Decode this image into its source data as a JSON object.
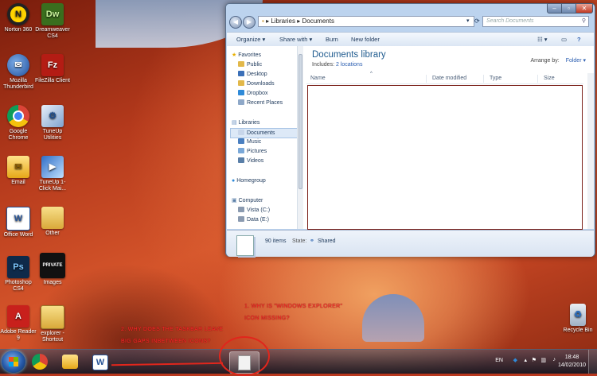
{
  "desktop": {
    "icons": [
      {
        "label": "Norton 360",
        "icon": "norton-icon"
      },
      {
        "label": "Dreamweaver CS4",
        "icon": "dreamweaver-icon"
      },
      {
        "label": "Mozilla Thunderbird",
        "icon": "thunderbird-icon"
      },
      {
        "label": "FileZilla Client",
        "icon": "filezilla-icon"
      },
      {
        "label": "Google Chrome",
        "icon": "chrome-icon"
      },
      {
        "label": "TuneUp Utilities",
        "icon": "tuneup-icon"
      },
      {
        "label": "Email",
        "icon": "email-icon"
      },
      {
        "label": "TuneUp 1-Click Mai...",
        "icon": "tuneup-1click-icon"
      },
      {
        "label": "Office Word",
        "icon": "word-icon"
      },
      {
        "label": "Other",
        "icon": "folder-icon"
      },
      {
        "label": "Photoshop CS4",
        "icon": "photoshop-icon"
      },
      {
        "label": "Images",
        "icon": "images-icon",
        "overlay": "PRIVATE"
      },
      {
        "label": "Adobe Reader 9",
        "icon": "adobe-reader-icon"
      },
      {
        "label": "explorer - Shortcut",
        "icon": "explorer-shortcut-icon"
      },
      {
        "label": "Recycle Bin",
        "icon": "recycle-bin-icon"
      }
    ]
  },
  "window": {
    "address": {
      "segments": [
        "Libraries",
        "Documents"
      ]
    },
    "search_placeholder": "Search Documents",
    "toolbar": {
      "organize": "Organize",
      "share_with": "Share with",
      "burn": "Burn",
      "new_folder": "New folder"
    },
    "nav": {
      "favorites": {
        "title": "Favorites",
        "items": [
          "Public",
          "Desktop",
          "Downloads",
          "Dropbox",
          "Recent Places"
        ]
      },
      "libraries": {
        "title": "Libraries",
        "items": [
          "Documents",
          "Music",
          "Pictures",
          "Videos"
        ]
      },
      "homegroup": "Homegroup",
      "computer": {
        "title": "Computer",
        "items": [
          "Vista (C:)",
          "Data (E:)"
        ]
      }
    },
    "library": {
      "title": "Documents library",
      "includes_label": "Includes:",
      "includes_link": "2 locations",
      "arrange_label": "Arrange by:",
      "arrange_value": "Folder"
    },
    "columns": [
      "Name",
      "Date modified",
      "Type",
      "Size"
    ],
    "details": {
      "count": "90 items",
      "state_label": "State:",
      "state_value": "Shared"
    }
  },
  "annotations": {
    "note1_line1": "1. WHY IS \"WINDOWS EXPLORER\"",
    "note1_line2": "ICON MISSING?",
    "note2_line1": "2. WHY DOES THE TASKBAR LEAVE",
    "note2_line2": "BIG GAPS INBETWEEN ICONS?"
  },
  "taskbar": {
    "language": "EN",
    "time": "18:48",
    "date": "14/02/2010"
  },
  "colors": {
    "annotation": "#e1261c",
    "library_title": "#1e5a8e",
    "link": "#2a5db0"
  }
}
